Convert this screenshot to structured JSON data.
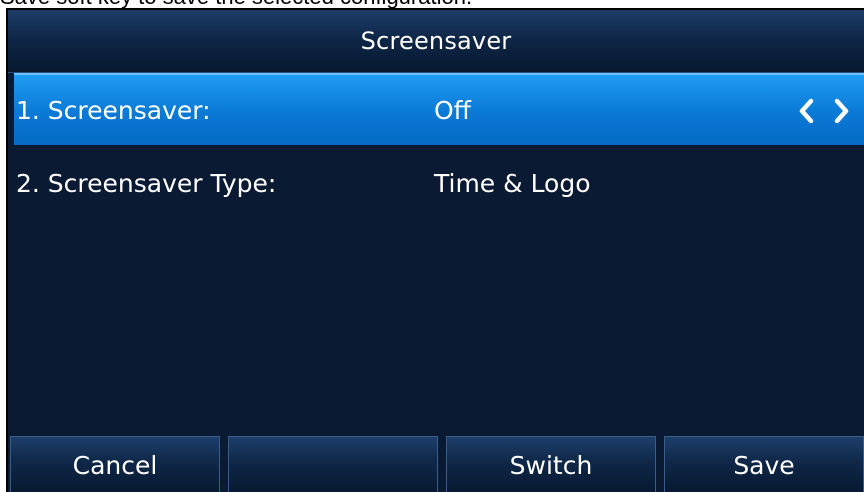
{
  "caption": "Save soft key to save the selected configuration.",
  "header": {
    "title": "Screensaver"
  },
  "menu": {
    "items": [
      {
        "label": "1. Screensaver:",
        "value": "Off",
        "selected": true
      },
      {
        "label": "2. Screensaver Type:",
        "value": "Time & Logo",
        "selected": false
      }
    ]
  },
  "softkeys": [
    {
      "label": "Cancel"
    },
    {
      "label": ""
    },
    {
      "label": "Switch"
    },
    {
      "label": "Save"
    }
  ],
  "colors": {
    "screen_background": "#0a1a33",
    "selected_row": "#0a79d6",
    "text": "#ffffff"
  },
  "icons": [
    "chevron-left-icon",
    "chevron-right-icon"
  ]
}
